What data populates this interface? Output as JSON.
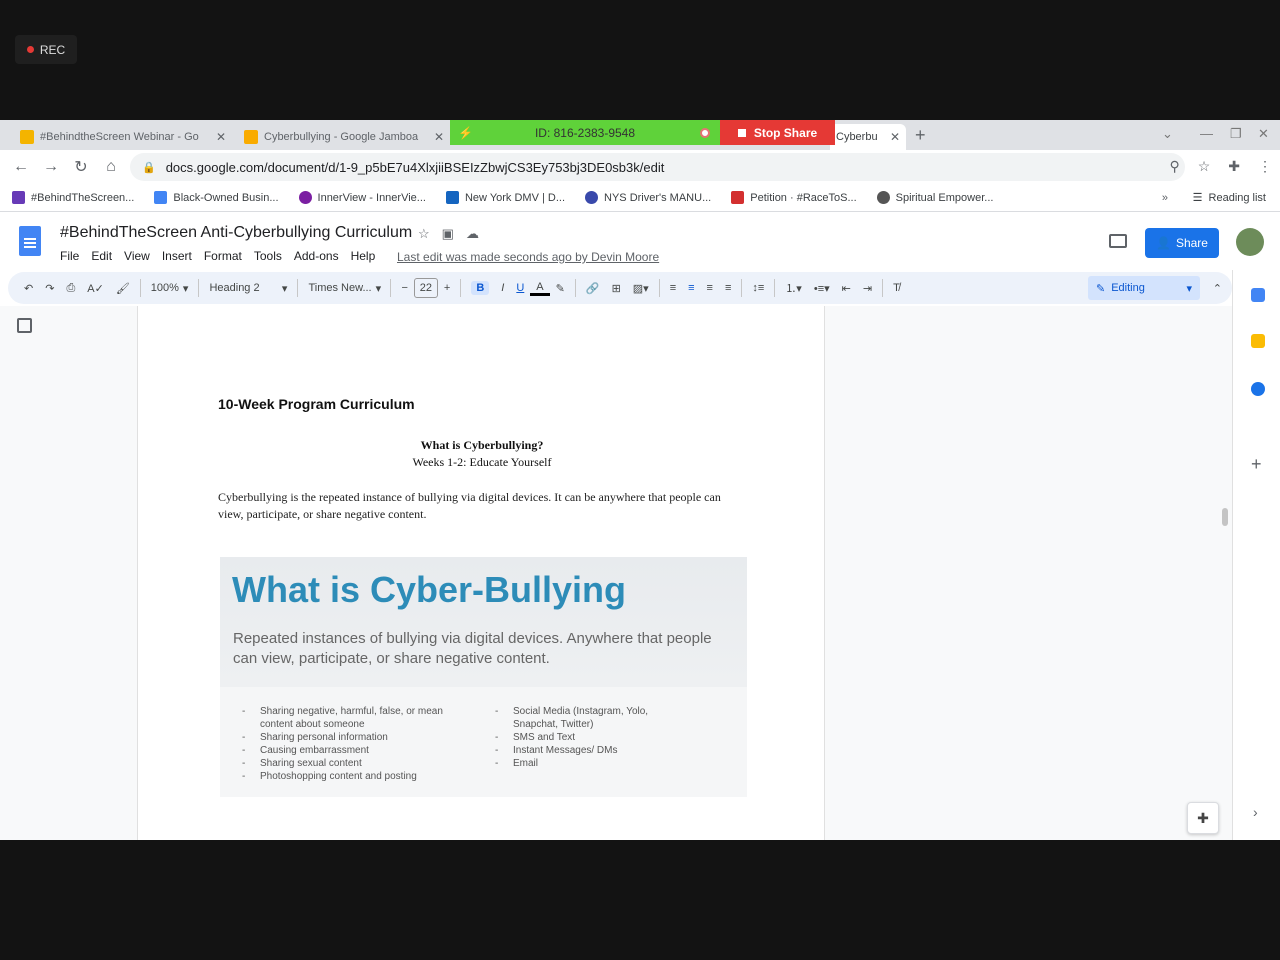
{
  "recording": {
    "label": "REC"
  },
  "browser": {
    "tabs": [
      {
        "title": "#BehindtheScreen Webinar - Go",
        "color": "#f4b400"
      },
      {
        "title": "Cyberbullying - Google Jamboa",
        "color": "#f9ab00"
      },
      {
        "title": "Cyberbu",
        "color": "#4285f4"
      }
    ],
    "zoom_meeting_id": "ID: 816-2383-9548",
    "stop_share_label": "Stop Share",
    "new_tab_icon": "plus-icon",
    "url": "docs.google.com/document/d/1-9_p5bE7u4XlxjiiBSEIzZbwjCS3Ey753bj3DE0sb3k/edit",
    "bookmarks": [
      {
        "label": "#BehindTheScreen...",
        "color": "#673ab7"
      },
      {
        "label": "Black-Owned Busin...",
        "color": "#4285f4"
      },
      {
        "label": "InnerView - InnerVie...",
        "color": "#7b1fa2"
      },
      {
        "label": "New York DMV | D...",
        "color": "#1565c0"
      },
      {
        "label": "NYS Driver's MANU...",
        "color": "#3949ab"
      },
      {
        "label": "Petition · #RaceToS...",
        "color": "#d32f2f"
      },
      {
        "label": "Spiritual Empower...",
        "color": "#555555"
      }
    ],
    "bookmarks_more": "»",
    "reading_list": "Reading list"
  },
  "doc": {
    "title": "#BehindTheScreen Anti-Cyberbullying Curriculum",
    "menus": [
      "File",
      "Edit",
      "View",
      "Insert",
      "Format",
      "Tools",
      "Add-ons",
      "Help"
    ],
    "last_edit": "Last edit was made seconds ago by Devin Moore",
    "share_label": "Share",
    "toolbar": {
      "zoom": "100%",
      "style": "Heading 2",
      "font": "Times New...",
      "font_size": "22",
      "mode": "Editing"
    },
    "heading": "10-Week Program Curriculum",
    "section_title": "What is Cyberbullying?",
    "section_subtitle": "Weeks 1-2: Educate Yourself",
    "paragraph": "Cyberbullying is the repeated instance of bullying via digital devices. It can be anywhere that people can view, participate, or share negative content.",
    "embed": {
      "title": "What is Cyber-Bullying",
      "subtitle": "Repeated instances of bullying via digital devices. Anywhere that people can view, participate, or share negative content.",
      "left_list": [
        "Sharing negative, harmful, false, or mean content about someone",
        "Sharing personal information",
        "Causing embarrassment",
        "Sharing sexual content",
        "Photoshopping content and posting"
      ],
      "right_list": [
        "Social Media (Instagram, Yolo, Snapchat, Twitter)",
        "SMS and Text",
        "Instant Messages/ DMs",
        "Email"
      ]
    }
  }
}
